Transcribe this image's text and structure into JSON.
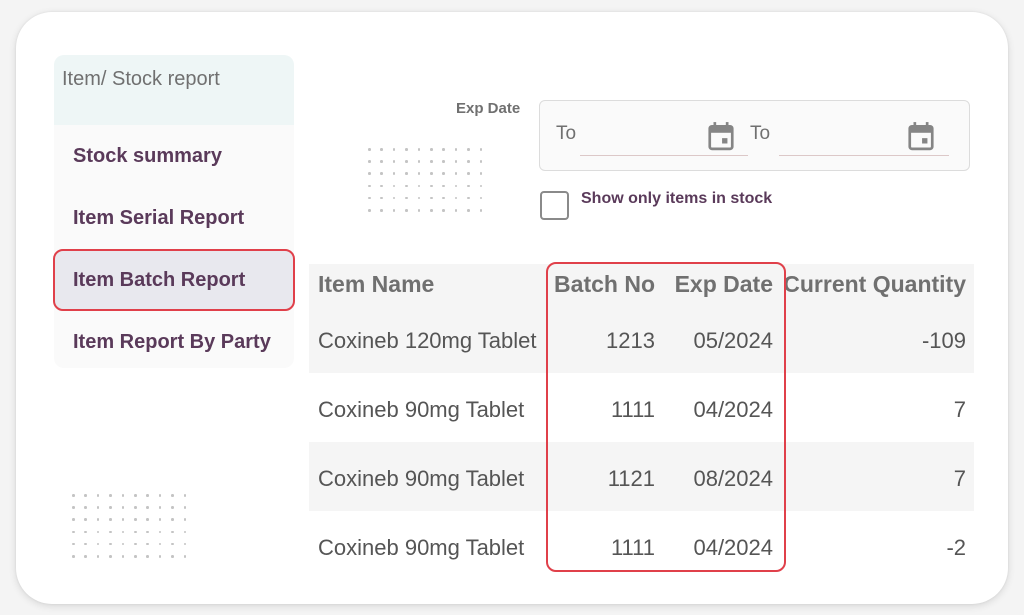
{
  "sidebar": {
    "header": "Item/ Stock report",
    "items": [
      {
        "label": "Stock summary",
        "active": false
      },
      {
        "label": "Item Serial Report",
        "active": false
      },
      {
        "label": "Item Batch Report",
        "active": true
      },
      {
        "label": "Item Report By Party",
        "active": false
      }
    ]
  },
  "filter": {
    "exp_date_label": "Exp Date",
    "from_label": "To",
    "from_value": "",
    "to_label": "To",
    "to_value": "",
    "calendar_icon": "calendar-icon",
    "checkbox_label": "Show only items in stock",
    "checkbox_checked": false
  },
  "table": {
    "columns": [
      "Item Name",
      "Batch No",
      "Exp Date",
      "Current Quantity"
    ],
    "rows": [
      {
        "item_name": "Coxineb 120mg Tablet",
        "batch_no": "1213",
        "exp_date": "05/2024",
        "current_quantity": "-109"
      },
      {
        "item_name": "Coxineb 90mg Tablet",
        "batch_no": "1111",
        "exp_date": "04/2024",
        "current_quantity": "7"
      },
      {
        "item_name": "Coxineb 90mg Tablet",
        "batch_no": "1121",
        "exp_date": "08/2024",
        "current_quantity": "7"
      },
      {
        "item_name": "Coxineb 90mg Tablet",
        "batch_no": "1111",
        "exp_date": "04/2024",
        "current_quantity": "-2"
      }
    ]
  },
  "colors": {
    "accent_text": "#5a3a5a",
    "highlight_border": "#e0404a",
    "sidebar_header_bg": "#eef6f6"
  }
}
